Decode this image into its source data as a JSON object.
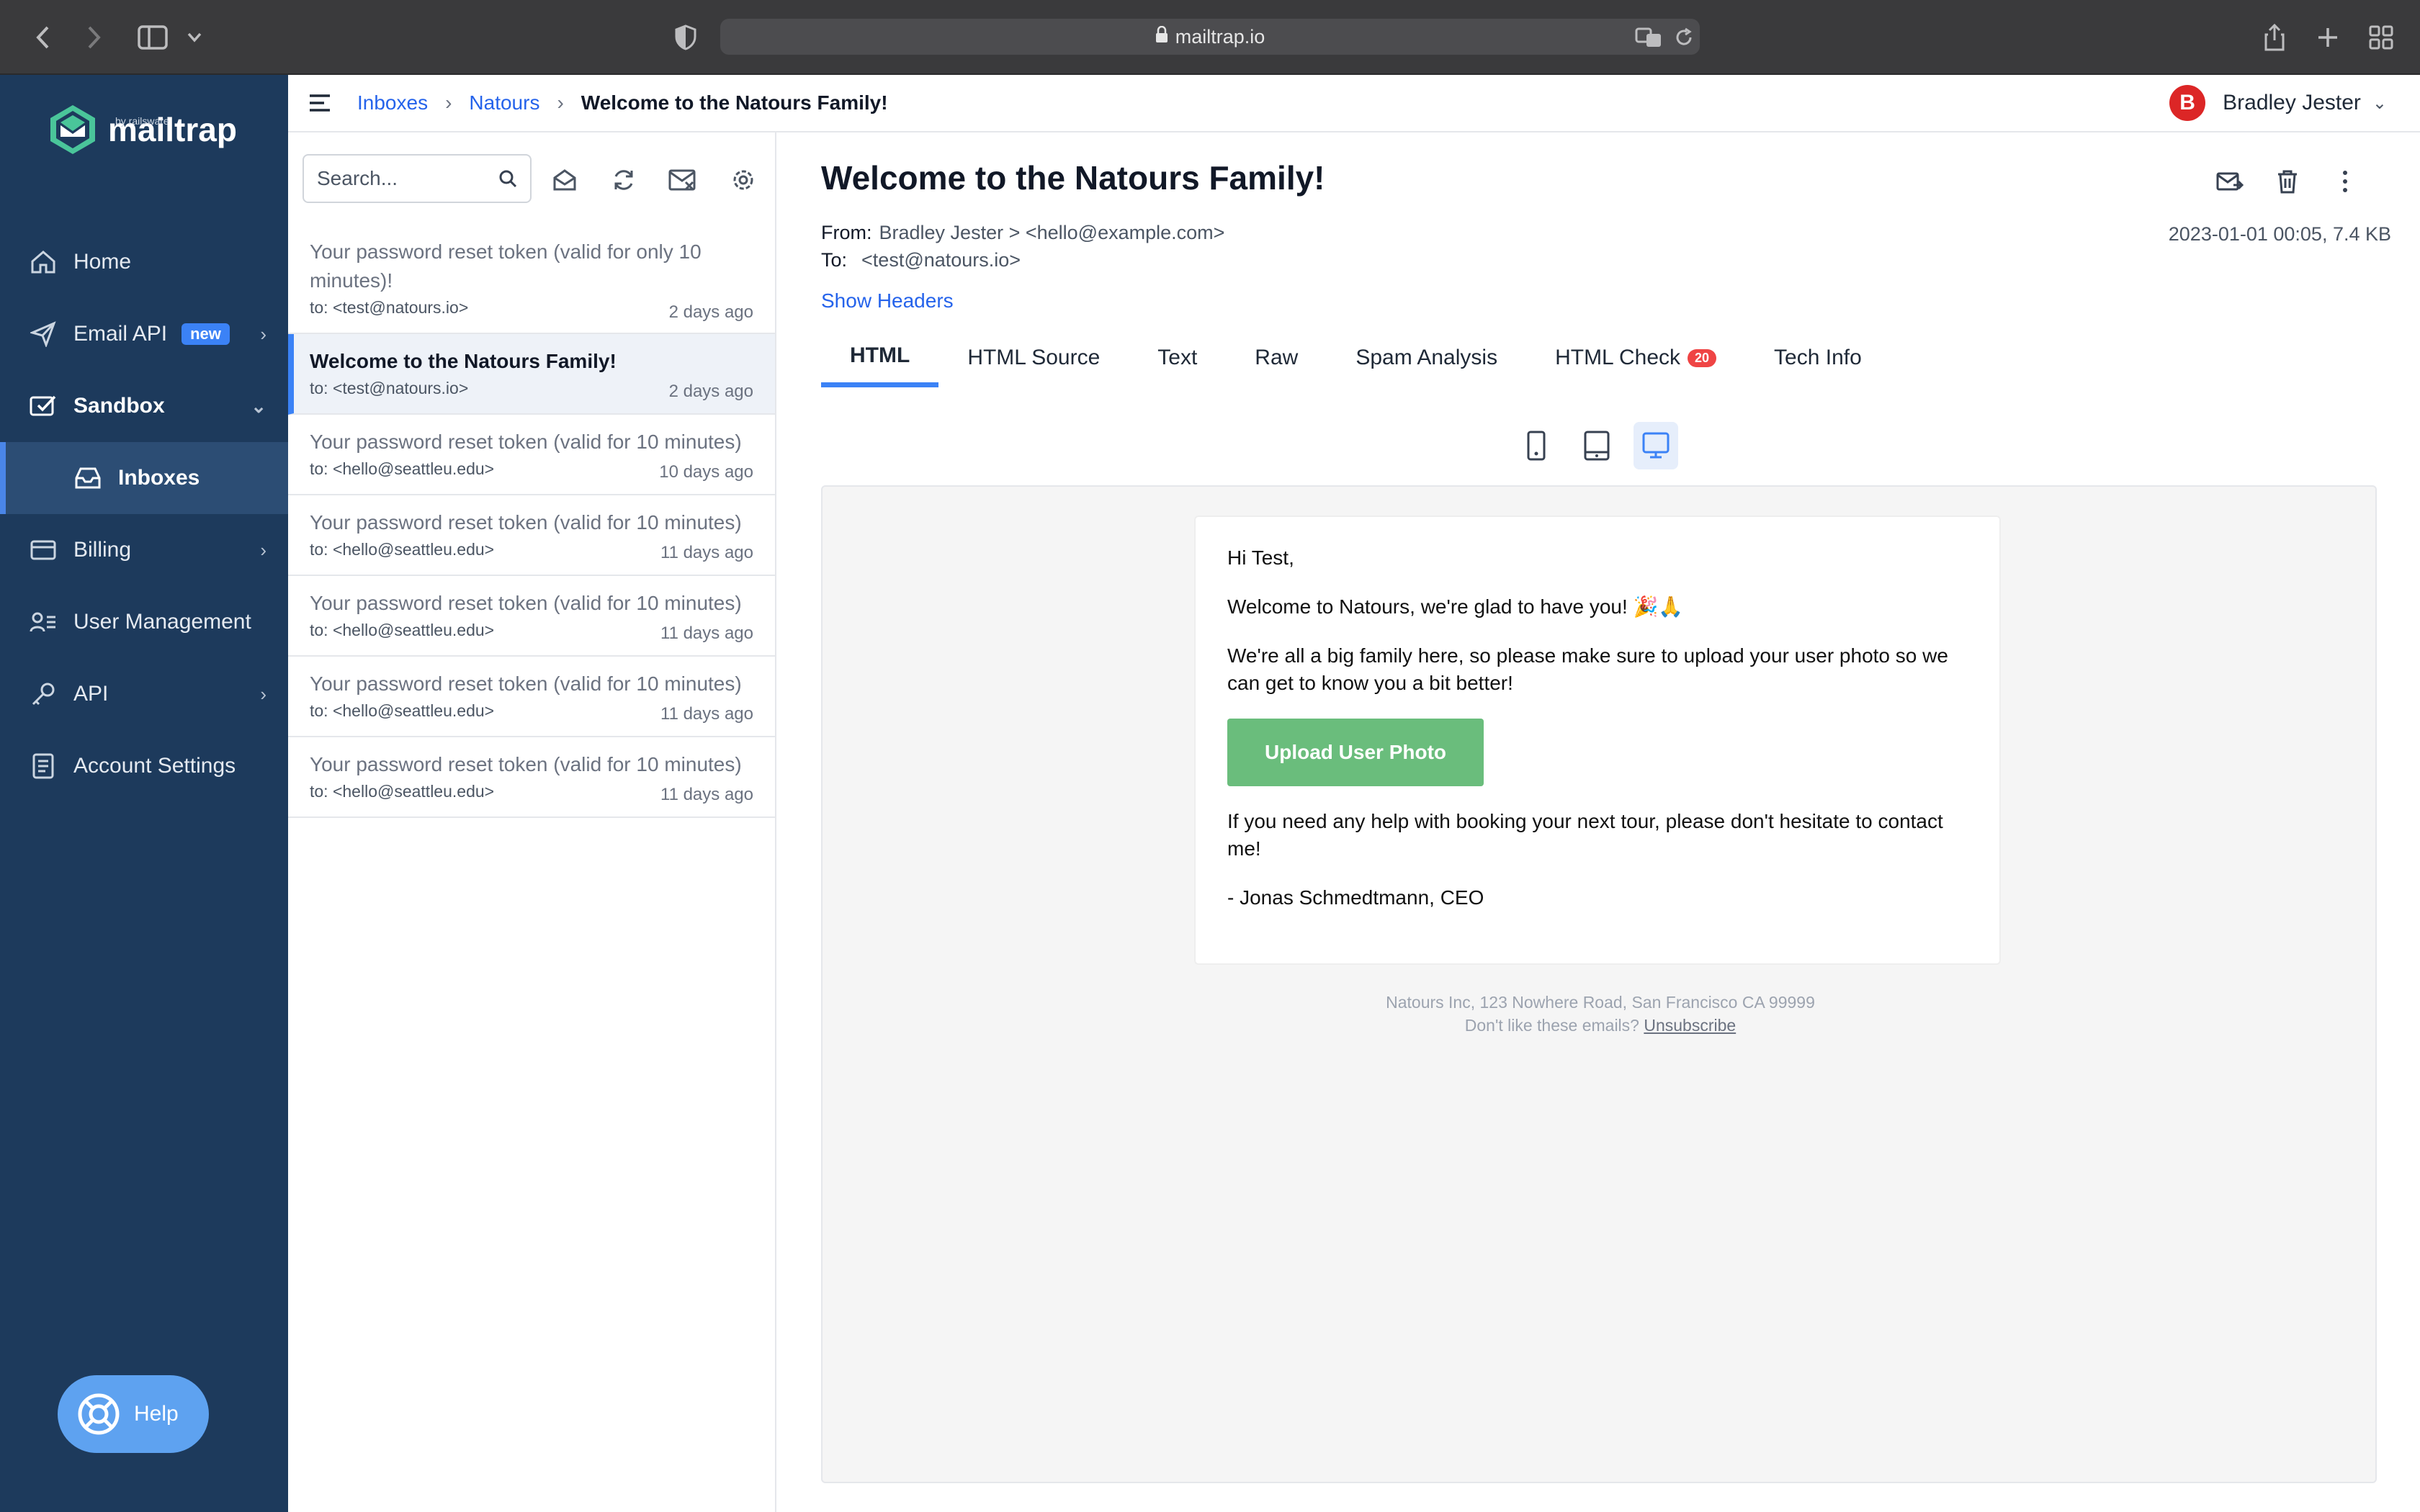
{
  "browser": {
    "url": "mailtrap.io"
  },
  "brand": {
    "name": "mailtrap",
    "sub": "by railsware"
  },
  "sidebar": {
    "items": [
      {
        "label": "Home"
      },
      {
        "label": "Email API",
        "badge": "new"
      },
      {
        "label": "Sandbox"
      },
      {
        "label": "Inboxes"
      },
      {
        "label": "Billing"
      },
      {
        "label": "User Management"
      },
      {
        "label": "API"
      },
      {
        "label": "Account Settings"
      }
    ],
    "help": "Help"
  },
  "header": {
    "breadcrumb": [
      "Inboxes",
      "Natours",
      "Welcome to the Natours Family!"
    ],
    "user_initial": "B",
    "user_name": "Bradley Jester"
  },
  "list": {
    "search_placeholder": "Search...",
    "messages": [
      {
        "subject": "Your password reset token (valid for only 10 minutes)!",
        "to": "to: <test@natours.io>",
        "date": "2 days ago"
      },
      {
        "subject": "Welcome to the Natours Family!",
        "to": "to: <test@natours.io>",
        "date": "2 days ago"
      },
      {
        "subject": "Your password reset token (valid for 10 minutes)",
        "to": "to: <hello@seattleu.edu>",
        "date": "10 days ago"
      },
      {
        "subject": "Your password reset token (valid for 10 minutes)",
        "to": "to: <hello@seattleu.edu>",
        "date": "11 days ago"
      },
      {
        "subject": "Your password reset token (valid for 10 minutes)",
        "to": "to: <hello@seattleu.edu>",
        "date": "11 days ago"
      },
      {
        "subject": "Your password reset token (valid for 10 minutes)",
        "to": "to: <hello@seattleu.edu>",
        "date": "11 days ago"
      },
      {
        "subject": "Your password reset token (valid for 10 minutes)",
        "to": "to: <hello@seattleu.edu>",
        "date": "11 days ago"
      }
    ]
  },
  "detail": {
    "title": "Welcome to the Natours Family!",
    "from_label": "From:",
    "from_value": "Bradley Jester > <hello@example.com>",
    "to_label": "To:",
    "to_value": "<test@natours.io>",
    "date_size": "2023-01-01 00:05, 7.4 KB",
    "show_headers": "Show Headers",
    "tabs": [
      {
        "label": "HTML"
      },
      {
        "label": "HTML Source"
      },
      {
        "label": "Text"
      },
      {
        "label": "Raw"
      },
      {
        "label": "Spam Analysis"
      },
      {
        "label": "HTML Check",
        "count": "20"
      },
      {
        "label": "Tech Info"
      }
    ]
  },
  "email": {
    "greeting": "Hi Test,",
    "welcome": "Welcome to Natours, we're glad to have you! 🎉🙏",
    "body1": "We're all a big family here, so please make sure to upload your user photo so we can get to know you a bit better!",
    "button": "Upload User Photo",
    "body2": "If you need any help with booking your next tour, please don't hesitate to contact me!",
    "signature": "- Jonas Schmedtmann, CEO",
    "footer_address": "Natours Inc, 123 Nowhere Road, San Francisco CA 99999",
    "footer_prompt": "Don't like these emails?",
    "footer_link": "Unsubscribe"
  },
  "colors": {
    "sidebar_bg": "#1d3a5c",
    "accent": "#3b82f6",
    "cta": "#6abd7c",
    "badge_red": "#ef4444"
  }
}
